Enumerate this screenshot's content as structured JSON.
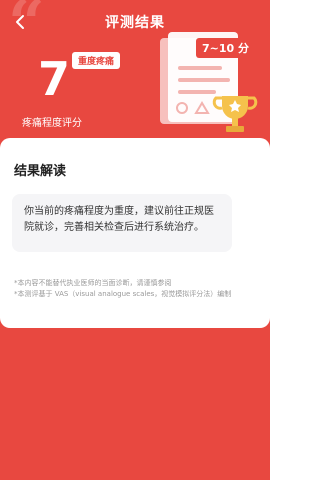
{
  "header": {
    "title": "评测结果",
    "back_icon": "chevron-left-icon"
  },
  "score": {
    "value": "7",
    "label": "疼痛程度评分",
    "severity": "重度疼痛"
  },
  "illustration": {
    "range_label": "7~10 分"
  },
  "result": {
    "section_title": "结果解读",
    "text": "你当前的疼痛程度为重度，建议前往正规医院就诊，完善相关检查后进行系统治疗。",
    "note_lines": [
      "*本内容不能替代执业医师的当面诊断，请谨慎参阅",
      "*本测评基于 VAS（visual analogue scales，视觉模拟评分法）编制"
    ]
  },
  "colors": {
    "primary": "#E84840",
    "card_bg": "#FFFFFF",
    "result_box_bg": "#F5F5F7"
  }
}
